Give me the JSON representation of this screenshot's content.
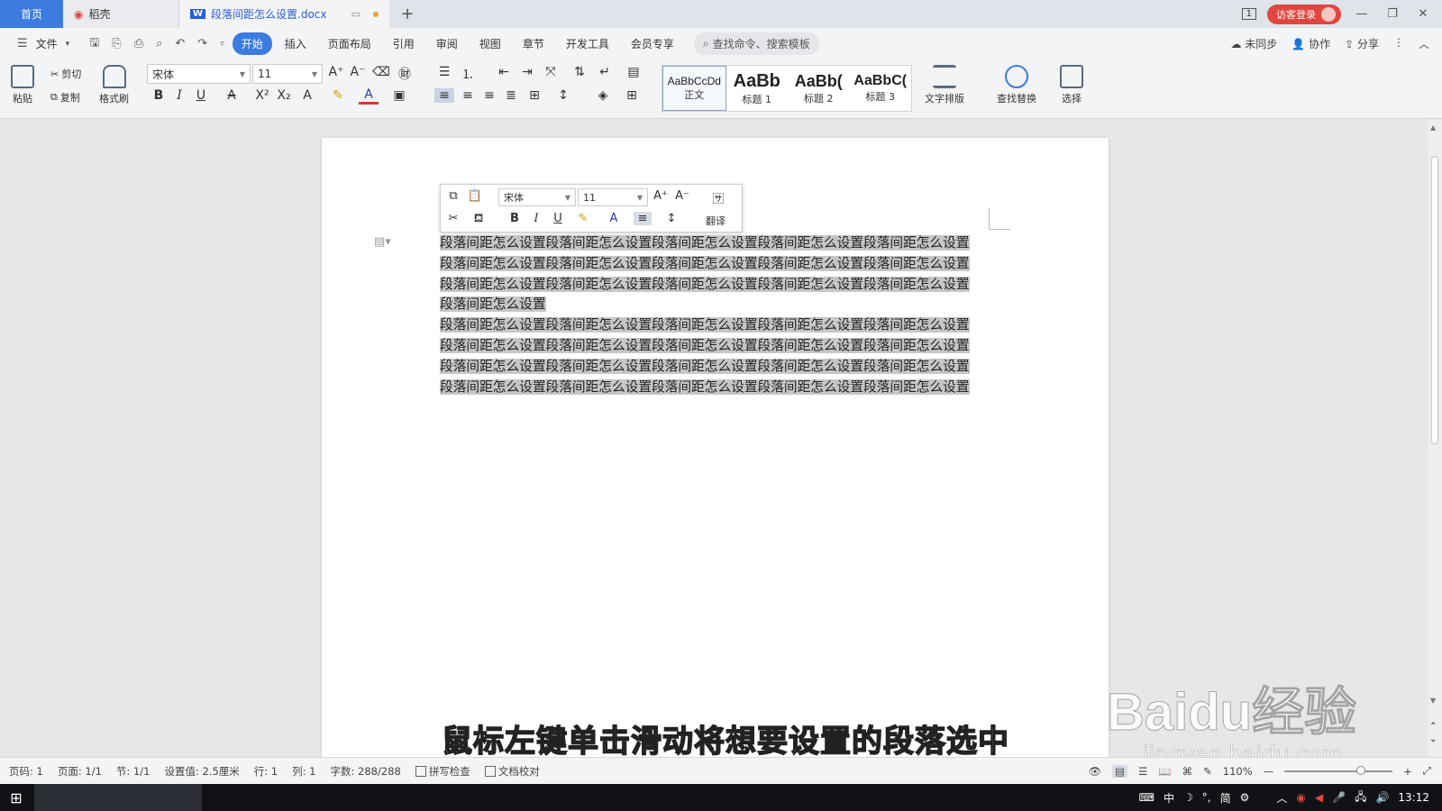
{
  "tabs": {
    "home": "首页",
    "daoke": "稻壳",
    "doc": "段落间距怎么设置.docx",
    "new": "+"
  },
  "titlebar": {
    "login": "访客登录",
    "badge": "1"
  },
  "menu": {
    "file": "文件",
    "items": [
      "开始",
      "插入",
      "页面布局",
      "引用",
      "审阅",
      "视图",
      "章节",
      "开发工具",
      "会员专享"
    ],
    "search": "查找命令、搜索模板",
    "sync": "未同步",
    "collab": "协作",
    "share": "分享"
  },
  "ribbon": {
    "paste": "粘贴",
    "cut": "剪切",
    "copy": "复制",
    "format_painter": "格式刷",
    "font_name": "宋体",
    "font_size": "11",
    "styles": [
      {
        "preview": "AaBbCcDd",
        "label": "正文"
      },
      {
        "preview": "AaBb",
        "label": "标题 1"
      },
      {
        "preview": "AaBb(",
        "label": "标题 2"
      },
      {
        "preview": "AaBbC(",
        "label": "标题 3"
      }
    ],
    "text_layout": "文字排版",
    "find_replace": "查找替换",
    "select": "选择"
  },
  "minibar": {
    "font_name": "宋体",
    "font_size": "11",
    "translate": "翻译"
  },
  "document": {
    "paragraphs": [
      "段落间距怎么设置段落间距怎么设置段落间距怎么设置段落间距怎么设置段落间距怎么设置段落间距怎么设置段落间距怎么设置段落间距怎么设置段落间距怎么设置段落间距怎么设置段落间距怎么设置段落间距怎么设置段落间距怎么设置段落间距怎么设置段落间距怎么设置段落间距怎么设置",
      "段落间距怎么设置段落间距怎么设置段落间距怎么设置段落间距怎么设置段落间距怎么设置段落间距怎么设置段落间距怎么设置段落间距怎么设置段落间距怎么设置段落间距怎么设置",
      "段落间距怎么设置段落间距怎么设置段落间距怎么设置段落间距怎么设置段落间距怎么设置段落间距怎么设置段落间距怎么设置段落间距怎么设置段落间距怎么设置段落间距怎么设置"
    ]
  },
  "subtitle": "鼠标左键单击滑动将想要设置的段落选中",
  "watermark": {
    "main": "Baidu经验",
    "sub": "jingyan.baidu.com"
  },
  "status": {
    "page_num": "页码: 1",
    "pages": "页面: 1/1",
    "section": "节: 1/1",
    "setting": "设置值: 2.5厘米",
    "row": "行: 1",
    "col": "列: 1",
    "words": "字数: 288/288",
    "spell": "拼写检查",
    "proof": "文档校对",
    "zoom": "110%"
  },
  "taskbar": {
    "ime": "中",
    "ime_mode": "简",
    "time": "13:12"
  }
}
